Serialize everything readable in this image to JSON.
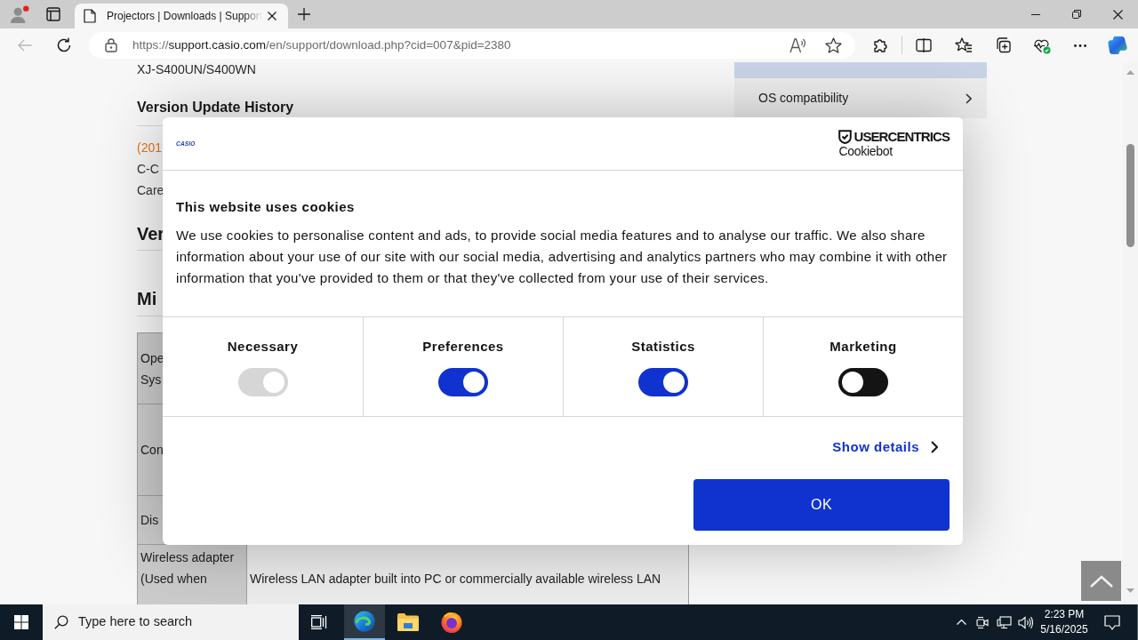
{
  "browser": {
    "tabs": [
      {
        "title": "Projectors | Downloads | Support",
        "selected": true
      }
    ],
    "navigation": {
      "back_disabled": true
    },
    "address": {
      "scheme": "https://",
      "host": "support.casio.com",
      "path": "/en/support/download.php?cid=007&pid=2380"
    }
  },
  "page": {
    "product": "XJ-S400UN/S400WN",
    "history": {
      "heading": "Version Update History",
      "lines": [
        {
          "kind": "date",
          "text": "(201"
        },
        {
          "kind": "plain",
          "text": "C-C"
        },
        {
          "kind": "plain",
          "text": "Care"
        }
      ]
    },
    "section_headings": [
      "Ver",
      "Mi"
    ],
    "requirements": [
      {
        "header_lines": [
          "Ope",
          "Sys"
        ]
      },
      {
        "header_lines": [
          "Con"
        ]
      },
      {
        "header_lines": [
          "Dis"
        ]
      },
      {
        "header_lines": [
          "Wireless adapter",
          "(Used when"
        ],
        "value": "Wireless LAN adapter built into PC or commercially available wireless LAN"
      }
    ],
    "sidebar": [
      {
        "selected": true
      },
      {
        "label": "OS compatibility",
        "selected": false
      }
    ]
  },
  "cookie_dialog": {
    "logo": "CASIO",
    "provider": {
      "name": "USERCENTRICS",
      "product": "Cookiebot"
    },
    "title": "This website uses cookies",
    "body": "We use cookies to personalise content and ads, to provide social media features and to analyse our traffic. We also share information about your use of our site with our social media, advertising and analytics partners who may combine it with other information that you've provided to them or that they've collected from your use of their services.",
    "categories": [
      {
        "label": "Necessary",
        "checked": true,
        "disabled": true
      },
      {
        "label": "Preferences",
        "checked": true,
        "disabled": false
      },
      {
        "label": "Statistics",
        "checked": true,
        "disabled": false
      },
      {
        "label": "Marketing",
        "checked": false,
        "disabled": false
      }
    ],
    "details_link": "Show details",
    "ok_button": "OK"
  },
  "taskbar": {
    "search_placeholder": "Type here to search",
    "apps": [
      {
        "kind": "task_view",
        "selected": false
      },
      {
        "kind": "browser",
        "selected": true
      },
      {
        "kind": "files",
        "selected": false
      },
      {
        "kind": "fox",
        "selected": false
      }
    ],
    "time": "2:23 PM",
    "date": "5/16/2025"
  }
}
